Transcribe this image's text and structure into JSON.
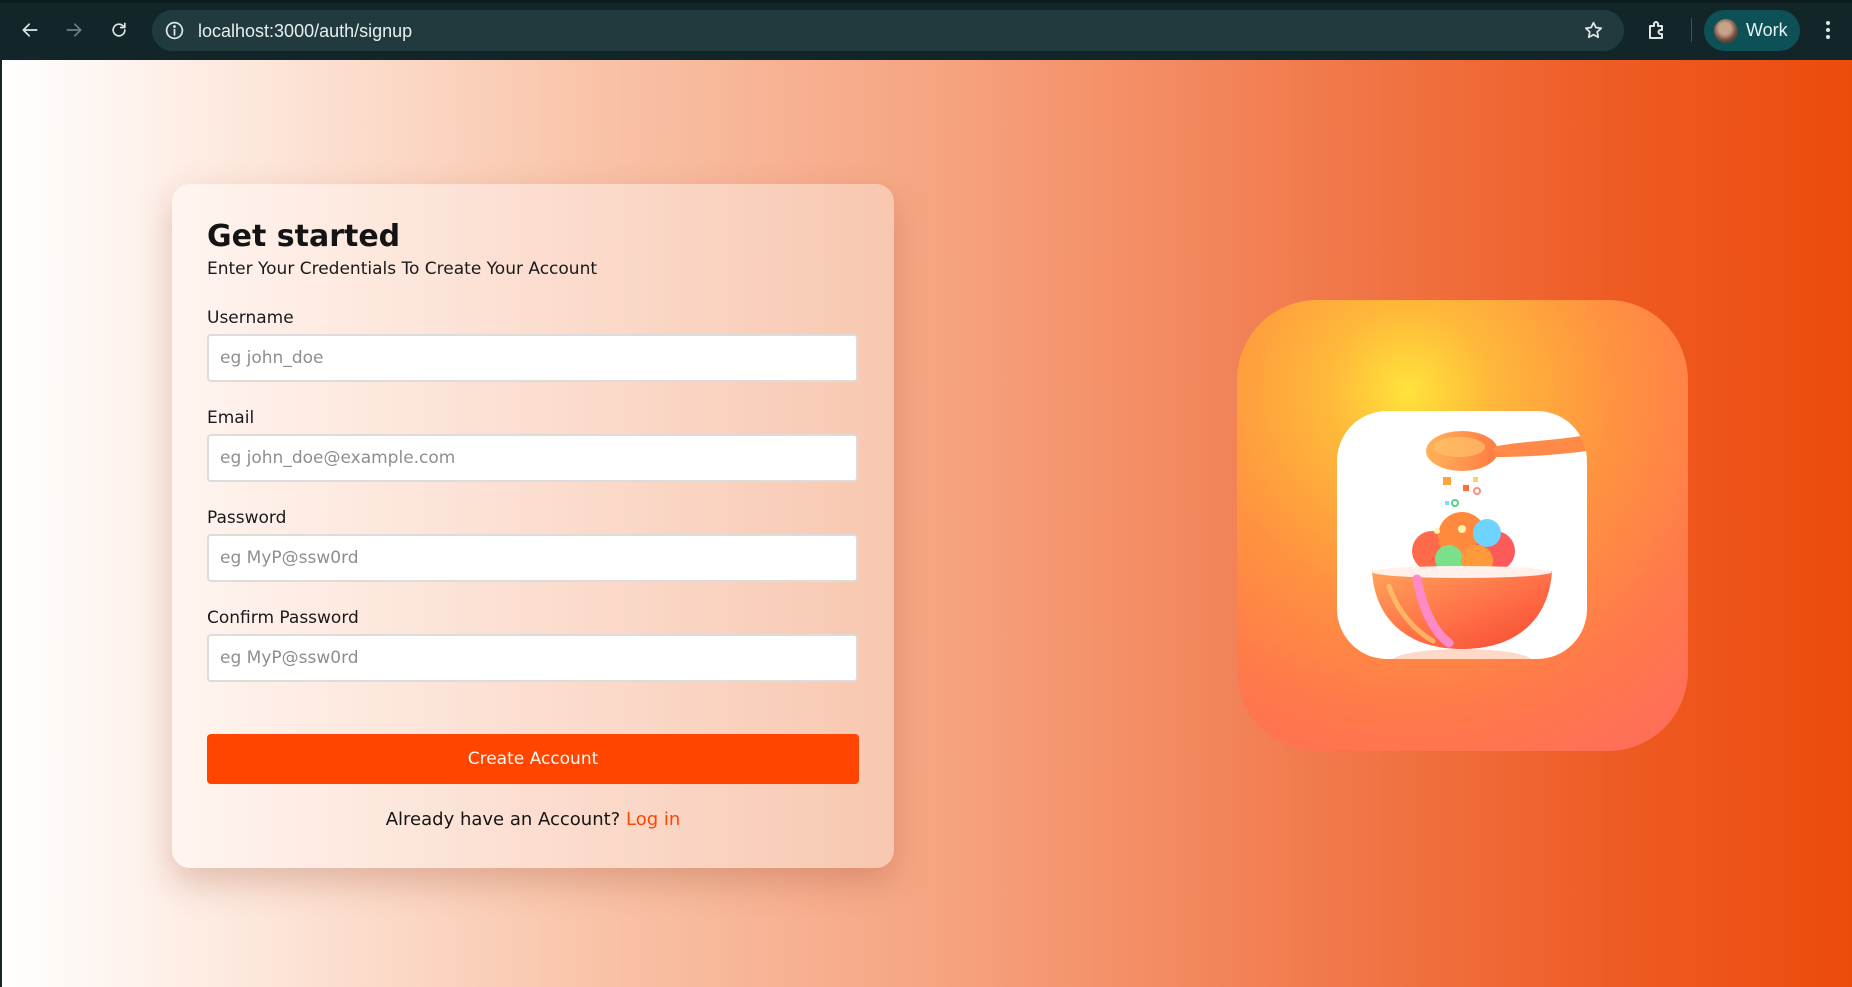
{
  "browser": {
    "url": "localhost:3000/auth/signup",
    "profile_name": "Work",
    "icons": {
      "back": "arrow-left-icon",
      "forward": "arrow-right-icon",
      "reload": "reload-icon",
      "site_info": "info-icon",
      "bookmark": "star-icon",
      "extensions": "puzzle-icon",
      "menu": "kebab-menu-icon"
    }
  },
  "signup": {
    "title": "Get started",
    "subtitle": "Enter Your Credentials To Create Your Account",
    "fields": [
      {
        "label": "Username",
        "placeholder": "eg john_doe",
        "value": ""
      },
      {
        "label": "Email",
        "placeholder": "eg john_doe@example.com",
        "value": ""
      },
      {
        "label": "Password",
        "placeholder": "eg MyP@ssw0rd",
        "value": ""
      },
      {
        "label": "Confirm Password",
        "placeholder": "eg MyP@ssw0rd",
        "value": ""
      }
    ],
    "submit_label": "Create Account",
    "login_prompt": "Already have an Account?",
    "login_link": "Log in"
  },
  "logo": {
    "icon": "food-bowl-logo-icon"
  },
  "colors": {
    "accent": "#ff4500",
    "browser_bg": "#12262a",
    "omnibox_bg": "#213a3e",
    "profile_bg": "#0d5056"
  }
}
